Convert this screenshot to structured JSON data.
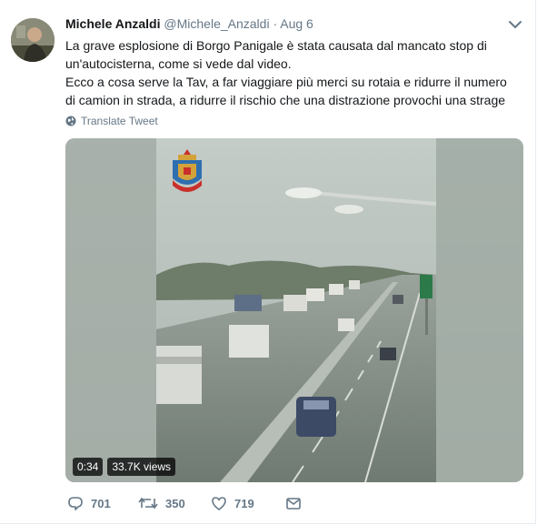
{
  "tweet": {
    "author_name": "Michele Anzaldi",
    "handle": "@Michele_Anzaldi",
    "separator": "·",
    "date": "Aug 6",
    "text_lines": [
      "La grave esplosione di Borgo Panigale è stata causata dal mancato stop di un'autocisterna, come si vede dal video.",
      "Ecco a cosa serve la Tav, a far viaggiare più merci su rotaia e ridurre il numero di camion in strada, a ridurre il rischio che una distrazione provochi una strage"
    ],
    "translate_label": "Translate Tweet"
  },
  "media": {
    "duration": "0:34",
    "views": "33.7K views"
  },
  "actions": {
    "replies": "701",
    "retweets": "350",
    "likes": "719"
  },
  "icons": {
    "caret": "chevron-down-icon",
    "globe": "globe-icon",
    "reply": "reply-icon",
    "retweet": "retweet-icon",
    "like": "heart-icon",
    "dm": "envelope-icon"
  },
  "colors": {
    "text": "#14171a",
    "muted": "#657786",
    "border": "#e6ecf0"
  }
}
